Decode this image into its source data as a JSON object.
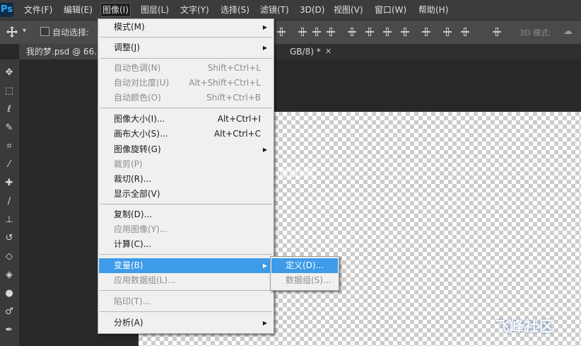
{
  "app": {
    "logo": "Ps"
  },
  "menubar": {
    "items": [
      "文件(F)",
      "编辑(E)",
      "图像(I)",
      "图层(L)",
      "文字(Y)",
      "选择(S)",
      "滤镜(T)",
      "3D(D)",
      "视图(V)",
      "窗口(W)",
      "帮助(H)"
    ]
  },
  "options": {
    "auto_select_label": "自动选择:",
    "mode3d_label": "3D 模式:",
    "auto_select_checked": false
  },
  "tabs": {
    "doc_title": "我的梦.psd @ 66.7",
    "doc_title_tail": "GB/8) *",
    "close_glyph": "✕"
  },
  "image_menu": {
    "items": [
      {
        "label": "模式(M)",
        "shortcut": "",
        "submenu": true,
        "disabled": false
      },
      {
        "label": "调整(J)",
        "shortcut": "",
        "submenu": true,
        "disabled": false
      },
      {
        "label": "自动色调(N)",
        "shortcut": "Shift+Ctrl+L",
        "submenu": false,
        "disabled": true
      },
      {
        "label": "自动对比度(U)",
        "shortcut": "Alt+Shift+Ctrl+L",
        "submenu": false,
        "disabled": true
      },
      {
        "label": "自动颜色(O)",
        "shortcut": "Shift+Ctrl+B",
        "submenu": false,
        "disabled": true
      },
      {
        "label": "图像大小(I)...",
        "shortcut": "Alt+Ctrl+I",
        "submenu": false,
        "disabled": false
      },
      {
        "label": "画布大小(S)...",
        "shortcut": "Alt+Ctrl+C",
        "submenu": false,
        "disabled": false
      },
      {
        "label": "图像旋转(G)",
        "shortcut": "",
        "submenu": true,
        "disabled": false
      },
      {
        "label": "裁剪(P)",
        "shortcut": "",
        "submenu": false,
        "disabled": true
      },
      {
        "label": "裁切(R)...",
        "shortcut": "",
        "submenu": false,
        "disabled": false
      },
      {
        "label": "显示全部(V)",
        "shortcut": "",
        "submenu": false,
        "disabled": false
      },
      {
        "label": "复制(D)...",
        "shortcut": "",
        "submenu": false,
        "disabled": false
      },
      {
        "label": "应用图像(Y)...",
        "shortcut": "",
        "submenu": false,
        "disabled": true
      },
      {
        "label": "计算(C)...",
        "shortcut": "",
        "submenu": false,
        "disabled": false
      },
      {
        "label": "变量(B)",
        "shortcut": "",
        "submenu": true,
        "disabled": false,
        "highlighted": true
      },
      {
        "label": "应用数据组(L)...",
        "shortcut": "",
        "submenu": false,
        "disabled": true
      },
      {
        "label": "陷印(T)...",
        "shortcut": "",
        "submenu": false,
        "disabled": true
      },
      {
        "label": "分析(A)",
        "shortcut": "",
        "submenu": true,
        "disabled": false
      }
    ]
  },
  "variables_submenu": {
    "items": [
      {
        "label": "定义(D)...",
        "highlighted": true,
        "disabled": false
      },
      {
        "label": "数据组(S)...",
        "highlighted": false,
        "disabled": true
      }
    ]
  },
  "watermark": {
    "center_text": "© 思CG网",
    "corner_text": "飞峰社区",
    "corner_sub": ""
  },
  "colors": {
    "menu_highlight": "#3d9be9",
    "menubar_bg": "#3c3c3c",
    "panel_bg": "#282828"
  }
}
